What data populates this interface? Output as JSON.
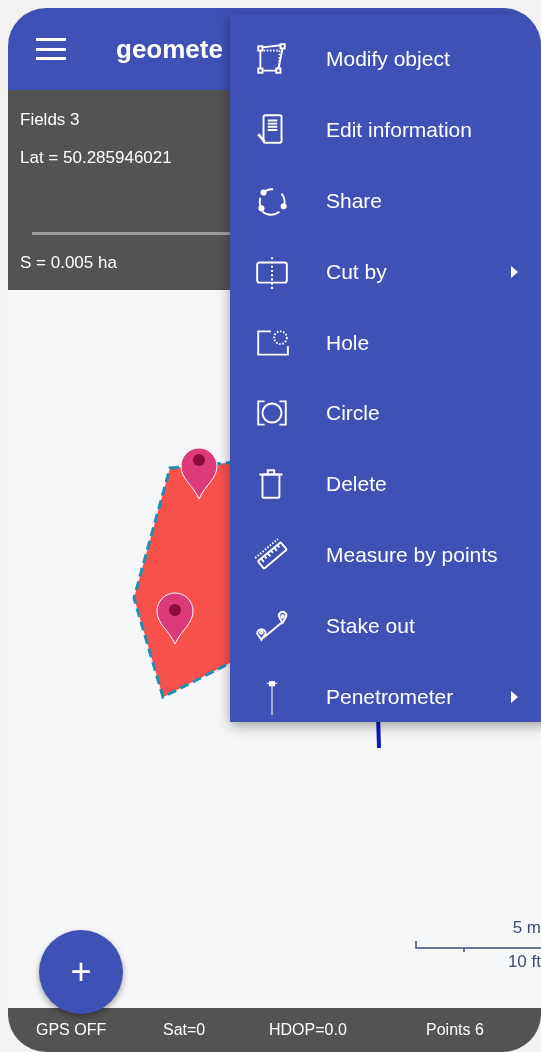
{
  "app_bar": {
    "title": "geomete"
  },
  "info_panel": {
    "lines": [
      "Fields 3",
      "Lat = 50.285946021"
    ],
    "area": "S = 0.005 ha"
  },
  "context_menu": {
    "items": [
      {
        "label": "Modify object",
        "has_submenu": false
      },
      {
        "label": "Edit information",
        "has_submenu": false
      },
      {
        "label": "Share",
        "has_submenu": false
      },
      {
        "label": "Cut by",
        "has_submenu": true
      },
      {
        "label": "Hole",
        "has_submenu": false
      },
      {
        "label": "Circle",
        "has_submenu": false
      },
      {
        "label": "Delete",
        "has_submenu": false
      },
      {
        "label": "Measure by points",
        "has_submenu": false
      },
      {
        "label": "Stake out",
        "has_submenu": false
      },
      {
        "label": "Penetrometer",
        "has_submenu": true
      }
    ]
  },
  "scale_bar": {
    "metric": "5 m",
    "imperial": "10 ft"
  },
  "fab": {
    "label": "+"
  },
  "status_bar": [
    "GPS OFF",
    "Sat=0",
    "HDOP=0.0",
    "Points 6"
  ]
}
